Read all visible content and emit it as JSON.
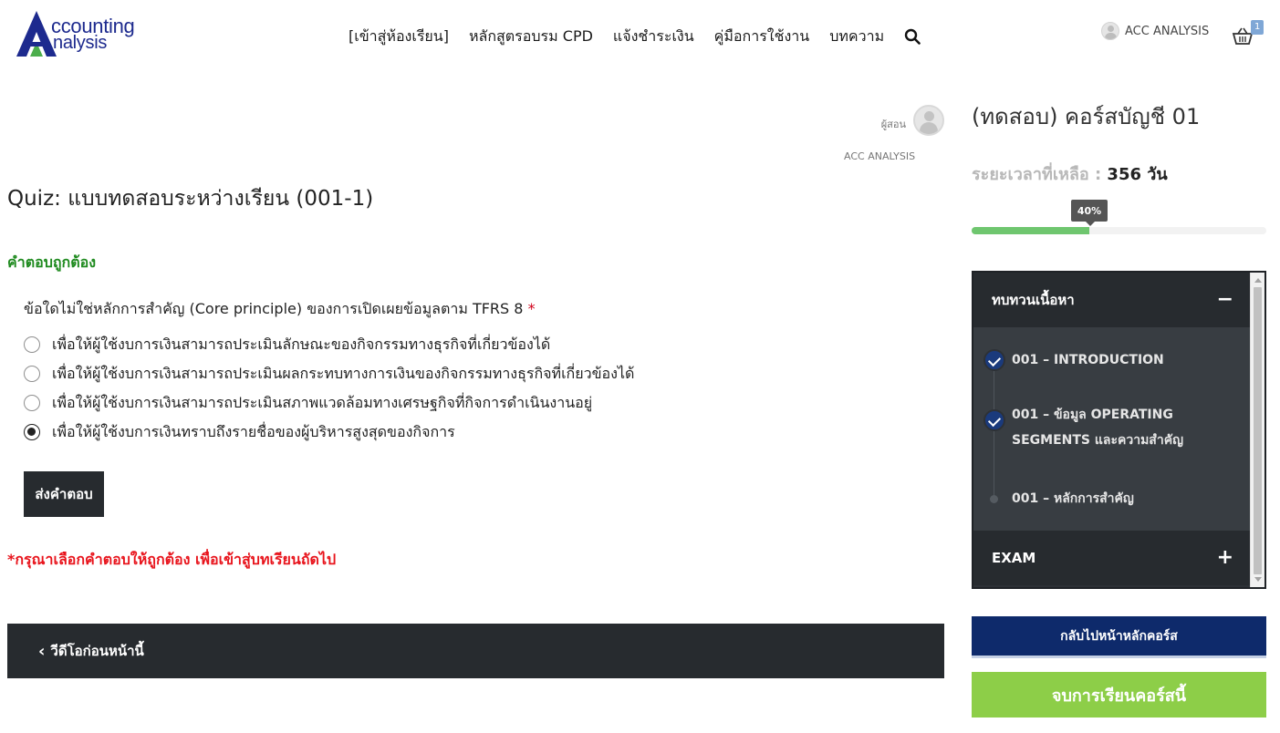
{
  "brand": {
    "line1": "ccounting",
    "line2": "nalysis",
    "accent": "#1d2a8e",
    "accent_green": "#4cae4c"
  },
  "nav": {
    "items": [
      "[เข้าสู่ห้องเรียน]",
      "หลักสูตรอบรม CPD",
      "แจ้งชำระเงิน",
      "คู่มือการใช้งาน",
      "บทความ"
    ],
    "search_icon": "search-icon"
  },
  "user": {
    "name": "ACC ANALYSIS",
    "cart_count": "1"
  },
  "instructor": {
    "role": "ผู้สอน",
    "name": "ACC ANALYSIS"
  },
  "quiz": {
    "title": "Quiz: แบบทดสอบระหว่างเรียน (001-1)",
    "result_message": "คำตอบถูกต้อง",
    "question": "ข้อใดไม่ใช่หลักการสำคัญ (Core principle) ของการเปิดเผยข้อมูลตาม TFRS 8",
    "required_mark": "*",
    "options": [
      {
        "text": "เพื่อให้ผู้ใช้งบการเงินสามารถประเมินลักษณะของกิจกรรมทางธุรกิจที่เกี่ยวข้องได้",
        "selected": false
      },
      {
        "text": "เพื่อให้ผู้ใช้งบการเงินสามารถประเมินผลกระทบทางการเงินของกิจกรรมทางธุรกิจที่เกี่ยวข้องได้",
        "selected": false
      },
      {
        "text": "เพื่อให้ผู้ใช้งบการเงินสามารถประเมินสภาพแวดล้อมทางเศรษฐกิจที่กิจการดำเนินงานอยู่",
        "selected": false
      },
      {
        "text": "เพื่อให้ผู้ใช้งบการเงินทราบถึงรายชื่อของผู้บริหารสูงสุดของกิจการ",
        "selected": true
      }
    ],
    "submit_label": "ส่งคำตอบ",
    "warning": "*กรุณาเลือกคำตอบให้ถูกต้อง เพื่อเข้าสู่บทเรียนถัดไป"
  },
  "prev_nav": {
    "label": "วีดีโอก่อนหน้านี้"
  },
  "sidebar": {
    "course_title": "(ทดสอบ) คอร์สบัญชี 01",
    "remaining_label": "ระยะเวลาที่เหลือ :",
    "remaining_value": "356 วัน",
    "progress_percent": 40,
    "progress_label": "40%",
    "sections": [
      {
        "title": "ทบทวนเนื้อหา",
        "toggle": "−",
        "lessons": [
          {
            "label": "001 – INTRODUCTION",
            "completed": true
          },
          {
            "label": "001 – ข้อมูล OPERATING SEGMENTS และความสำคัญ",
            "completed": true
          },
          {
            "label": "001 – หลักการสำคัญ",
            "completed": false
          }
        ]
      },
      {
        "title": "EXAM",
        "toggle": "+",
        "lessons": []
      }
    ],
    "back_button": "กลับไปหน้าหลักคอร์ส",
    "finish_button": "จบการเรียนคอร์สนี้"
  },
  "colors": {
    "success": "#1e8a1e",
    "error": "#e8141c",
    "dark": "#272b2f",
    "progress": "#6fc66f",
    "back_btn": "#0e2a6b",
    "finish_btn": "#8dce48"
  }
}
